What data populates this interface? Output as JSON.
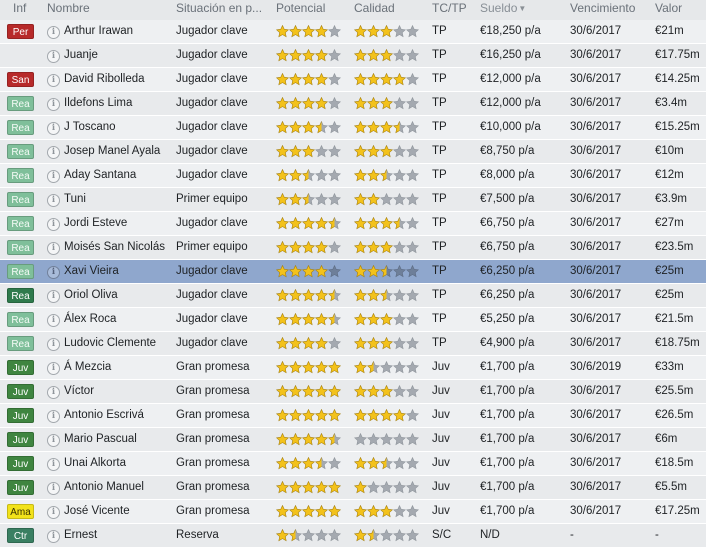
{
  "columns": {
    "inf": "Inf",
    "nombre": "Nombre",
    "situacion": "Situación en p...",
    "potencial": "Potencial",
    "calidad": "Calidad",
    "tctp": "TC/TP",
    "sueldo": "Sueldo",
    "vencimiento": "Vencimiento",
    "valor": "Valor"
  },
  "badge_colors": {
    "Per": "#b72a2a",
    "San": "#b72a2a",
    "Rea": "#5a9f78",
    "Juv": "#3f8540",
    "Ama": "#f2e21b",
    "Ctr": "#3a7f62"
  },
  "star_colors": {
    "filled": "#f3c21b",
    "empty": "#a4a9b0",
    "outline": "#b48a0c"
  },
  "players": [
    {
      "inf": "Per",
      "nombre": "Arthur Irawan",
      "situacion": "Jugador clave",
      "potencial": 4,
      "calidad": 3,
      "tctp": "TP",
      "sueldo": "€18,250 p/a",
      "vencimiento": "30/6/2017",
      "valor": "€21m"
    },
    {
      "inf": "",
      "nombre": "Juanje",
      "situacion": "Jugador clave",
      "potencial": 4,
      "calidad": 3,
      "tctp": "TP",
      "sueldo": "€16,250 p/a",
      "vencimiento": "30/6/2017",
      "valor": "€17.75m"
    },
    {
      "inf": "San",
      "nombre": "David Ribolleda",
      "situacion": "Jugador clave",
      "potencial": 4,
      "calidad": 4,
      "tctp": "TP",
      "sueldo": "€12,000 p/a",
      "vencimiento": "30/6/2017",
      "valor": "€14.25m"
    },
    {
      "inf": "Rea",
      "nombre": "Ildefons Lima",
      "situacion": "Jugador clave",
      "potencial": 4,
      "calidad": 3,
      "tctp": "TP",
      "sueldo": "€12,000 p/a",
      "vencimiento": "30/6/2017",
      "valor": "€3.4m"
    },
    {
      "inf": "Rea",
      "nombre": "J Toscano",
      "situacion": "Jugador clave",
      "potencial": 3.5,
      "calidad": 3.5,
      "tctp": "TP",
      "sueldo": "€10,000 p/a",
      "vencimiento": "30/6/2017",
      "valor": "€15.25m"
    },
    {
      "inf": "Rea",
      "nombre": "Josep Manel Ayala",
      "situacion": "Jugador clave",
      "potencial": 3,
      "calidad": 3,
      "tctp": "TP",
      "sueldo": "€8,750 p/a",
      "vencimiento": "30/6/2017",
      "valor": "€10m"
    },
    {
      "inf": "Rea",
      "nombre": "Aday Santana",
      "situacion": "Jugador clave",
      "potencial": 2.5,
      "calidad": 2.5,
      "tctp": "TP",
      "sueldo": "€8,000 p/a",
      "vencimiento": "30/6/2017",
      "valor": "€12m"
    },
    {
      "inf": "Rea",
      "nombre": "Tuni",
      "situacion": "Primer equipo",
      "potencial": 2.5,
      "calidad": 2,
      "tctp": "TP",
      "sueldo": "€7,500 p/a",
      "vencimiento": "30/6/2017",
      "valor": "€3.9m"
    },
    {
      "inf": "Rea",
      "nombre": "Jordi Esteve",
      "situacion": "Jugador clave",
      "potencial": 4.5,
      "calidad": 3.5,
      "tctp": "TP",
      "sueldo": "€6,750 p/a",
      "vencimiento": "30/6/2017",
      "valor": "€27m"
    },
    {
      "inf": "Rea",
      "nombre": "Moisés San Nicolás",
      "situacion": "Primer equipo",
      "potencial": 4,
      "calidad": 3,
      "tctp": "TP",
      "sueldo": "€6,750 p/a",
      "vencimiento": "30/6/2017",
      "valor": "€23.5m"
    },
    {
      "inf": "Rea",
      "nombre": "Xavi Vieira",
      "situacion": "Jugador clave",
      "potencial": 4,
      "calidad": 2.5,
      "tctp": "TP",
      "sueldo": "€6,250 p/a",
      "vencimiento": "30/6/2017",
      "valor": "€25m",
      "selected": true
    },
    {
      "inf": "Rea",
      "nombre": "Oriol Oliva",
      "situacion": "Jugador clave",
      "potencial": 4.5,
      "calidad": 2.5,
      "tctp": "TP",
      "sueldo": "€6,250 p/a",
      "vencimiento": "30/6/2017",
      "valor": "€25m"
    },
    {
      "inf": "Rea",
      "nombre": "Álex Roca",
      "situacion": "Jugador clave",
      "potencial": 4.5,
      "calidad": 3,
      "tctp": "TP",
      "sueldo": "€5,250 p/a",
      "vencimiento": "30/6/2017",
      "valor": "€21.5m"
    },
    {
      "inf": "Rea",
      "nombre": "Ludovic Clemente",
      "situacion": "Jugador clave",
      "potencial": 4,
      "calidad": 3,
      "tctp": "TP",
      "sueldo": "€4,900 p/a",
      "vencimiento": "30/6/2017",
      "valor": "€18.75m"
    },
    {
      "inf": "Juv",
      "nombre": "Á Mezcia",
      "situacion": "Gran promesa",
      "potencial": 5,
      "calidad": 1.5,
      "tctp": "Juv",
      "sueldo": "€1,700 p/a",
      "vencimiento": "30/6/2019",
      "valor": "€33m"
    },
    {
      "inf": "Juv",
      "nombre": "Víctor",
      "situacion": "Gran promesa",
      "potencial": 5,
      "calidad": 3,
      "tctp": "Juv",
      "sueldo": "€1,700 p/a",
      "vencimiento": "30/6/2017",
      "valor": "€25.5m"
    },
    {
      "inf": "Juv",
      "nombre": "Antonio Escrivá",
      "situacion": "Gran promesa",
      "potencial": 5,
      "calidad": 4,
      "tctp": "Juv",
      "sueldo": "€1,700 p/a",
      "vencimiento": "30/6/2017",
      "valor": "€26.5m"
    },
    {
      "inf": "Juv",
      "nombre": "Mario Pascual",
      "situacion": "Gran promesa",
      "potencial": 4.5,
      "calidad": 0,
      "tctp": "Juv",
      "sueldo": "€1,700 p/a",
      "vencimiento": "30/6/2017",
      "valor": "€6m"
    },
    {
      "inf": "Juv",
      "nombre": "Unai Alkorta",
      "situacion": "Gran promesa",
      "potencial": 3.5,
      "calidad": 2.5,
      "tctp": "Juv",
      "sueldo": "€1,700 p/a",
      "vencimiento": "30/6/2017",
      "valor": "€18.5m"
    },
    {
      "inf": "Juv",
      "nombre": "Antonio Manuel",
      "situacion": "Gran promesa",
      "potencial": 5,
      "calidad": 1,
      "tctp": "Juv",
      "sueldo": "€1,700 p/a",
      "vencimiento": "30/6/2017",
      "valor": "€5.5m"
    },
    {
      "inf": "Ama",
      "nombre": "José Vicente",
      "situacion": "Gran promesa",
      "potencial": 5,
      "calidad": 3,
      "tctp": "Juv",
      "sueldo": "€1,700 p/a",
      "vencimiento": "30/6/2017",
      "valor": "€17.25m"
    },
    {
      "inf": "Ctr",
      "nombre": "Ernest",
      "situacion": "Reserva",
      "potencial": 1.5,
      "calidad": 1.5,
      "tctp": "S/C",
      "sueldo": "N/D",
      "vencimiento": "-",
      "valor": "-"
    }
  ]
}
